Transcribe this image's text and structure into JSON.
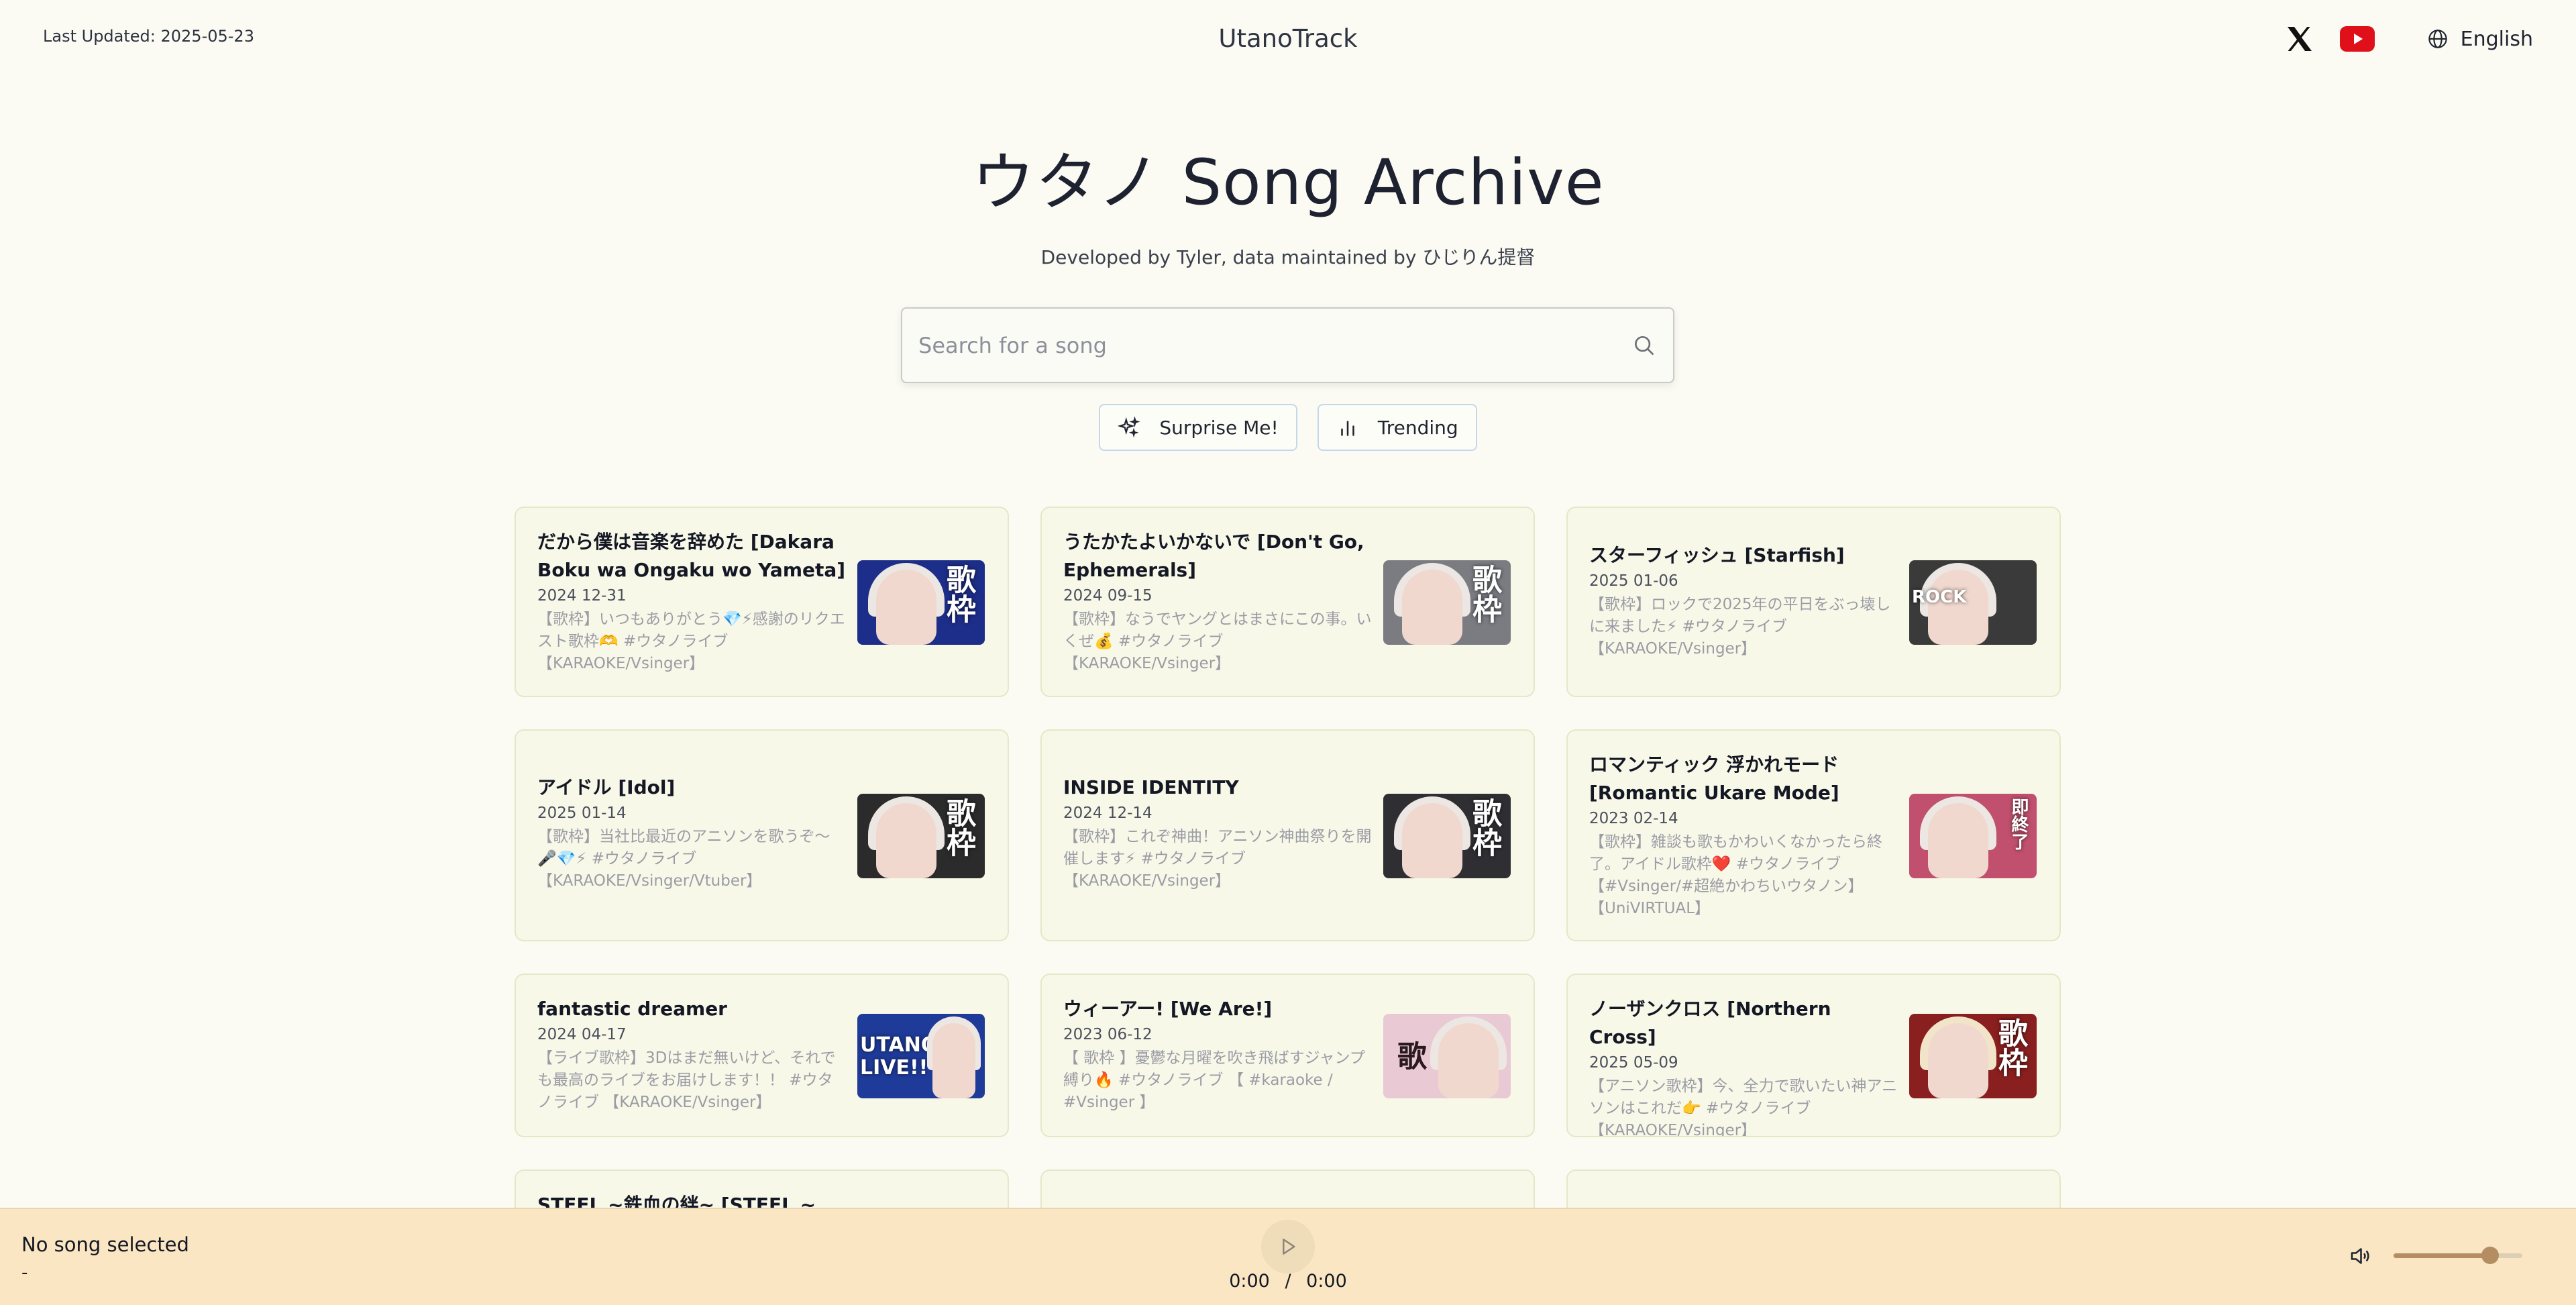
{
  "header": {
    "last_updated": "Last Updated: 2025-05-23",
    "brand": "UtanoTrack",
    "language": "English",
    "icons": [
      "x-icon",
      "youtube-icon",
      "globe-icon"
    ]
  },
  "hero": {
    "title": "ウタノ Song Archive",
    "subtitle": "Developed by Tyler, data maintained by ひじりん提督"
  },
  "search": {
    "placeholder": "Search for a song",
    "value": ""
  },
  "actions": {
    "surprise_label": "Surprise Me!",
    "trending_label": "Trending"
  },
  "songs": [
    {
      "name": "だから僕は音楽を辞めた [Dakara Boku wa Ongaku wo Yameta]",
      "date": "2024 12-31",
      "desc": "【歌枠】いつもありがとう💎⚡感謝のリクエスト歌枠🫶 #ウタノライブ 【KARAOKE/Vsinger】",
      "thumb": "歌枠",
      "thumb_color": "#1d2e8a"
    },
    {
      "name": "うたかたよいかないで [Don't Go, Ephemerals]",
      "date": "2024 09-15",
      "desc": "【歌枠】なうでヤングとはまさにこの事。いくぜ💰 #ウタノライブ 【KARAOKE/Vsinger】",
      "thumb": "歌枠",
      "thumb_color": "#7a7c82"
    },
    {
      "name": "スターフィッシュ [Starfish]",
      "date": "2025 01-06",
      "desc": "【歌枠】ロックで2025年の平日をぶっ壊しに来ました⚡ #ウタノライブ 【KARAOKE/Vsinger】",
      "thumb": "ROCK",
      "thumb_color": "#3a3a3a"
    },
    {
      "name": "アイドル [Idol]",
      "date": "2025 01-14",
      "desc": "【歌枠】当社比最近のアニソンを歌うぞ〜🎤💎⚡ #ウタノライブ 【KARAOKE/Vsinger/Vtuber】",
      "thumb": "歌枠",
      "thumb_color": "#2b2b2b"
    },
    {
      "name": "INSIDE IDENTITY",
      "date": "2024 12-14",
      "desc": "【歌枠】これぞ神曲！アニソン神曲祭りを開催します⚡ #ウタノライブ 【KARAOKE/Vsinger】",
      "thumb": "歌枠",
      "thumb_color": "#2f2f33"
    },
    {
      "name": "ロマンティック 浮かれモード [Romantic Ukare Mode]",
      "date": "2023 02-14",
      "desc": "【歌枠】雑談も歌もかわいくなかったら終了。アイドル歌枠❤️ #ウタノライブ 【#Vsinger/#超絶かわちいウタノン】【UniVIRTUAL】",
      "thumb": "即終了",
      "thumb_color": "#c0506e"
    },
    {
      "name": "fantastic dreamer",
      "date": "2024 04-17",
      "desc": "【ライブ歌枠】3Dはまだ無いけど、それでも最高のライブをお届けします！！ #ウタノライブ 【KARAOKE/Vsinger】",
      "thumb": "UTANO LIVE!!",
      "thumb_color": "#1f3b9a"
    },
    {
      "name": "ウィーアー! [We Are!]",
      "date": "2023 06-12",
      "desc": "【 歌枠 】憂鬱な月曜を吹き飛ばすジャンプ縛り🔥 #ウタノライブ 【 #karaoke / #Vsinger 】",
      "thumb": "歌",
      "thumb_color": "#e9c9d4"
    },
    {
      "name": "ノーザンクロス [Northern Cross]",
      "date": "2025 05-09",
      "desc": "【アニソン歌枠】今、全力で歌いたい神アニソンはこれだ👉 #ウタノライブ 【KARAOKE/Vsinger】",
      "thumb": "歌枠",
      "thumb_color": "#8a1f1f"
    },
    {
      "name": "STEEL ~鉄血の絆~ [STEEL ~",
      "date": "",
      "desc": "",
      "thumb": "",
      "thumb_color": "#f8f8e9"
    },
    {
      "name": "",
      "date": "",
      "desc": "",
      "thumb": "",
      "thumb_color": "#f8f8e9"
    },
    {
      "name": "",
      "date": "",
      "desc": "",
      "thumb": "",
      "thumb_color": "#f8f8e9"
    }
  ],
  "player": {
    "title": "No song selected",
    "artist": "-",
    "current_time": "0:00",
    "separator": "/",
    "duration": "0:00",
    "volume": 0.75
  }
}
